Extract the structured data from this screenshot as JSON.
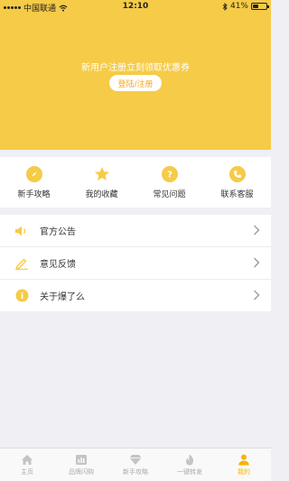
{
  "status": {
    "carrier": "中国联通",
    "time": "12:10",
    "battery": "41%",
    "battery_level": 0.41
  },
  "header": {
    "promo_text": "新用户注册立刻领取优惠券",
    "login_label": "登陆/注册"
  },
  "shortcuts": [
    {
      "label": "新手攻略",
      "icon": "compass-icon"
    },
    {
      "label": "我的收藏",
      "icon": "star-icon"
    },
    {
      "label": "常见问题",
      "icon": "question-icon"
    },
    {
      "label": "联系客服",
      "icon": "phone-icon"
    }
  ],
  "menu": [
    {
      "label": "官方公告",
      "icon": "speaker-icon"
    },
    {
      "label": "意见反馈",
      "icon": "pencil-icon"
    },
    {
      "label": "关于爆了么",
      "icon": "info-icon"
    }
  ],
  "tabbar": [
    {
      "label": "主页",
      "icon": "home-icon"
    },
    {
      "label": "品牌闪购",
      "icon": "chart-icon"
    },
    {
      "label": "新手攻略",
      "icon": "diamond-icon"
    },
    {
      "label": "一键转发",
      "icon": "flame-icon"
    },
    {
      "label": "我的",
      "icon": "person-icon",
      "active": true
    }
  ],
  "colors": {
    "accent": "#f5cb47",
    "active_tab": "#f5b400"
  }
}
